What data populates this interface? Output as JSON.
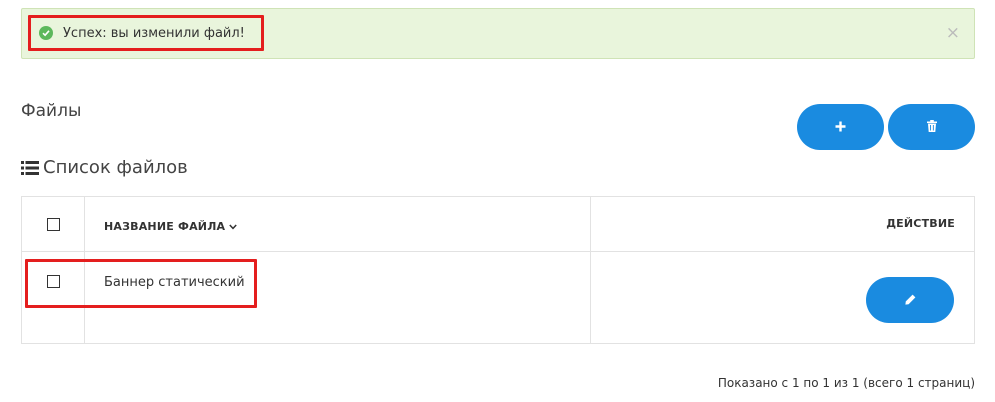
{
  "alert": {
    "message": "Успех: вы изменили файл!",
    "close_symbol": "×",
    "icon": "check-circle-icon",
    "color": "#e9f5dc"
  },
  "header": {
    "title": "Файлы",
    "add_icon": "plus-icon",
    "delete_icon": "trash-icon",
    "button_color": "#1a8be0"
  },
  "panel": {
    "title": "Список файлов",
    "icon": "list-icon"
  },
  "table": {
    "columns": {
      "name": "НАЗВАНИЕ ФАЙЛА",
      "action": "ДЕЙСТВИЕ"
    },
    "sort_icon": "chevron-down-icon",
    "rows": [
      {
        "name": "Баннер статический",
        "edit_icon": "pencil-icon"
      }
    ]
  },
  "pagination": {
    "info": "Показано с 1 по 1 из 1 (всего 1 страниц)"
  }
}
